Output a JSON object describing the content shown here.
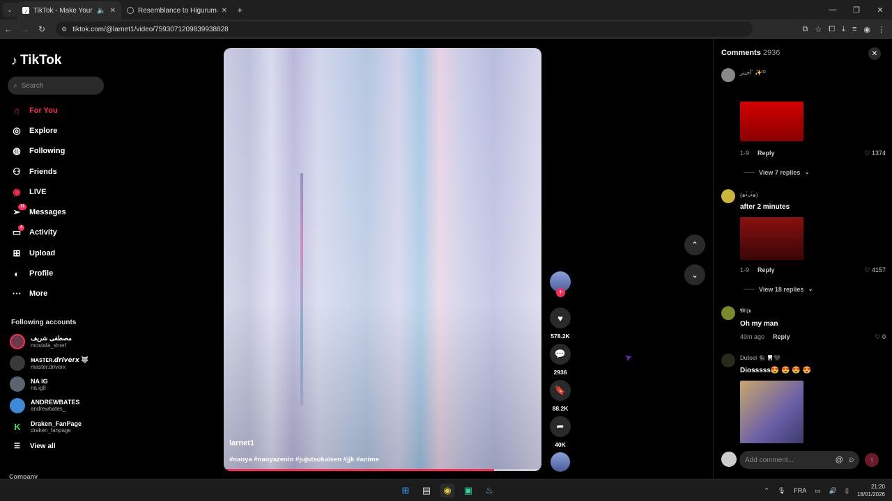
{
  "browser": {
    "tabs": [
      {
        "title": "TikTok - Make Your Day",
        "active": true
      },
      {
        "title": "Resemblance to Higuruma",
        "active": false
      }
    ],
    "url": "tiktok.com/@larnet1/video/7593071209839938828"
  },
  "sidebar": {
    "logo": "TikTok",
    "search_placeholder": "Search",
    "nav": [
      {
        "label": "For You",
        "icon": "home-icon"
      },
      {
        "label": "Explore",
        "icon": "compass-icon"
      },
      {
        "label": "Following",
        "icon": "following-icon"
      },
      {
        "label": "Friends",
        "icon": "friends-icon"
      },
      {
        "label": "LIVE",
        "icon": "live-icon"
      },
      {
        "label": "Messages",
        "icon": "messages-icon",
        "badge": "11"
      },
      {
        "label": "Activity",
        "icon": "activity-icon",
        "badge": "4"
      },
      {
        "label": "Upload",
        "icon": "upload-icon"
      },
      {
        "label": "Profile",
        "icon": "profile-icon"
      },
      {
        "label": "More",
        "icon": "more-icon"
      }
    ],
    "following_title": "Following accounts",
    "accounts": [
      {
        "name": "مصطفى شريف",
        "handle": "mostafa_shref"
      },
      {
        "name": "ᴍᴀsᴛᴇʀ.𝙙𝙧𝙞𝙫𝙚𝙧𝙭 🐺",
        "handle": "master.driverx"
      },
      {
        "name": "NA IG",
        "handle": "na.ig8"
      },
      {
        "name": "ANDREWBATES",
        "handle": "andrewbates_"
      },
      {
        "name": "Draken_FanPage",
        "handle": "draken_fanpage"
      }
    ],
    "view_all": "View all",
    "company": "Company"
  },
  "video": {
    "author": "larnet1",
    "hashtags": "#naoya #naoyazenin #jujutsukaisen #jjk #anime",
    "progress": 0.85,
    "likes": "578.2K",
    "comments": "2936",
    "saves": "88.2K",
    "shares": "40K"
  },
  "comments": {
    "title": "Comments",
    "count": "2936",
    "items": [
      {
        "user": "أخيتر´ ✨ᴵᴼ",
        "text": "",
        "meta": "1-9",
        "reply": "Reply",
        "likes": "1374",
        "view_replies": "View 7 replies"
      },
      {
        "user": "(๑•̀ᴗ•́๑)",
        "text": "after 2 minutes",
        "meta": "1-9",
        "reply": "Reply",
        "likes": "4157",
        "view_replies": "View 18 replies"
      },
      {
        "user": "𝕸𝖎𝖏𝖚",
        "text": "Oh my man",
        "meta": "49m ago",
        "reply": "Reply",
        "likes": "0"
      },
      {
        "user": "Dulisel 🐈‍⬛ 🦷🖤",
        "text": "Diosssss😍 😍 😍 😍"
      }
    ],
    "input_placeholder": "Add comment..."
  },
  "taskbar": {
    "lang": "FRA",
    "time": "21:20",
    "date": "18/01/2026"
  }
}
